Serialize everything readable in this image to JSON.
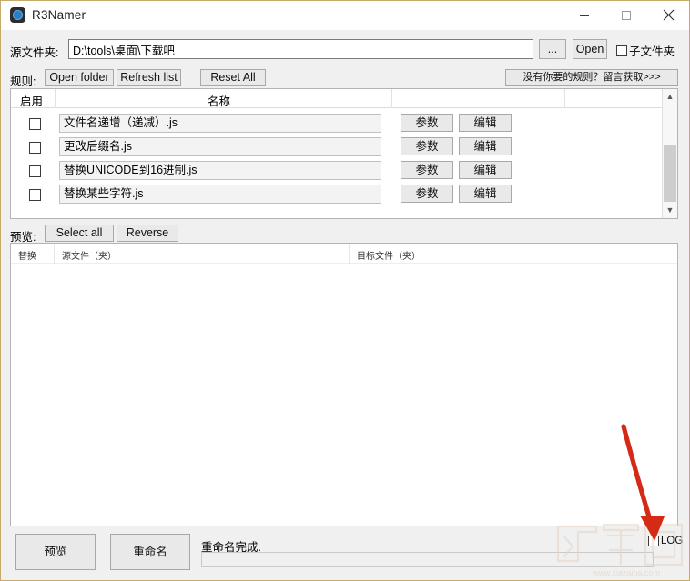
{
  "window": {
    "title": "R3Namer",
    "icon": "app-icon",
    "controls": {
      "minimize": "minimize-icon",
      "maximize": "maximize-icon",
      "close": "close-icon"
    }
  },
  "source": {
    "label": "源文件夹:",
    "path_value": "D:\\tools\\桌面\\下载吧",
    "path_placeholder": "",
    "browse_label": "...",
    "open_label": "Open",
    "subfolder_label": "子文件夹",
    "subfolder_checked": false
  },
  "rules_toolbar": {
    "label": "规则:",
    "open_folder_label": "Open folder",
    "refresh_list_label": "Refresh list",
    "reset_all_label": "Reset All",
    "get_rules_label": "没有你要的规则？留言获取>>>"
  },
  "rules_table": {
    "headers": {
      "enable": "启用",
      "name": "名称"
    },
    "param_label": "参数",
    "edit_label": "编辑",
    "rows": [
      {
        "checked": false,
        "name": "文件名递增（递减）.js"
      },
      {
        "checked": false,
        "name": "更改后缀名.js"
      },
      {
        "checked": false,
        "name": "替换UNICODE到16进制.js"
      },
      {
        "checked": false,
        "name": "替换某些字符.js"
      }
    ],
    "scrollbar": {
      "up_glyph": "▲",
      "down_glyph": "▼"
    }
  },
  "preview_toolbar": {
    "label": "预览:",
    "select_all_label": "Select all",
    "reverse_label": "Reverse"
  },
  "preview_table": {
    "headers": {
      "replace": "替换",
      "source": "源文件（夹）",
      "target": "目标文件（夹）"
    },
    "rows": []
  },
  "bottom": {
    "preview_label": "预览",
    "rename_label": "重命名",
    "status_text": "重命名完成.",
    "status_field_value": "",
    "log_label": "LOG",
    "log_checked": false
  },
  "annotation": {
    "arrow_color": "#d42a16",
    "arrow_target": "log-checkbox"
  },
  "watermark": {
    "site": "www.xiazaiba.com",
    "color": "#e8d9c8"
  }
}
